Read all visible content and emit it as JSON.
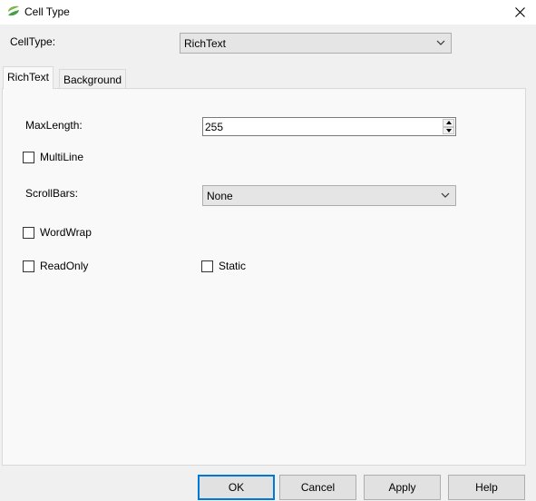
{
  "window": {
    "title": "Cell Type",
    "accent": "#0078d7"
  },
  "celltype": {
    "label": "CellType:",
    "selected": "RichText"
  },
  "tabs": [
    {
      "label": "RichText",
      "active": true
    },
    {
      "label": "Background",
      "active": false
    }
  ],
  "richtext": {
    "maxlength_label": "MaxLength:",
    "maxlength_value": "255",
    "multiline_label": "MultiLine",
    "multiline_checked": false,
    "scrollbars_label": "ScrollBars:",
    "scrollbars_selected": "None",
    "wordwrap_label": "WordWrap",
    "wordwrap_checked": false,
    "readonly_label": "ReadOnly",
    "readonly_checked": false,
    "static_label": "Static",
    "static_checked": false
  },
  "buttons": {
    "ok": "OK",
    "cancel": "Cancel",
    "apply": "Apply",
    "help": "Help"
  },
  "icons": {
    "app": "app-logo-icon",
    "close": "close-icon",
    "dropdown": "chevron-down-icon",
    "spin_up": "spin-up-icon",
    "spin_down": "spin-down-icon"
  }
}
